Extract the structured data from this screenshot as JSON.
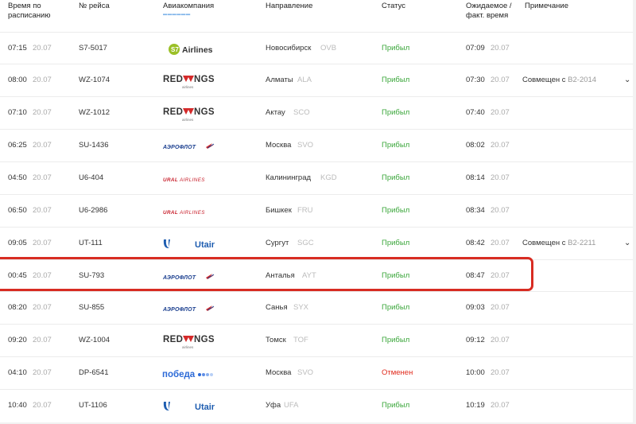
{
  "header": {
    "col_time": "Время по",
    "col_time_2": "расписанию",
    "col_flight": "№ рейса",
    "col_airline": "Авиакомпания",
    "col_direction": "Направление",
    "col_status": "Статус",
    "col_expected": "Ожидаемое /",
    "col_expected_2": "факт. время",
    "col_note": "Примечание"
  },
  "colors": {
    "arrived": "#3aa63a",
    "cancelled": "#e02a1c",
    "highlight": "#d82c22"
  },
  "rows": [
    {
      "time": "07:15",
      "date": "20.07",
      "flight": "S7-5017",
      "airline": "S7 Airlines",
      "city": "Новосибирск",
      "code": "OVB",
      "status": "Прибыл",
      "exp": "07:09",
      "exp_date": "20.07",
      "note": "",
      "note_code": ""
    },
    {
      "time": "08:00",
      "date": "20.07",
      "flight": "WZ-1074",
      "airline": "REDWINGS",
      "airline_sub": "airlines",
      "city": "Алматы",
      "code": "ALA",
      "status": "Прибыл",
      "exp": "07:30",
      "exp_date": "20.07",
      "note": "Совмещен с ",
      "note_code": "B2-2014"
    },
    {
      "time": "07:10",
      "date": "20.07",
      "flight": "WZ-1012",
      "airline": "REDWINGS",
      "airline_sub": "airlines",
      "city": "Актау",
      "code": "SCO",
      "status": "Прибыл",
      "exp": "07:40",
      "exp_date": "20.07",
      "note": "",
      "note_code": ""
    },
    {
      "time": "06:25",
      "date": "20.07",
      "flight": "SU-1436",
      "airline": "АЭРОФЛОТ",
      "city": "Москва",
      "code": "SVO",
      "status": "Прибыл",
      "exp": "08:02",
      "exp_date": "20.07",
      "note": "",
      "note_code": ""
    },
    {
      "time": "04:50",
      "date": "20.07",
      "flight": "U6-404",
      "airline": "URAL AIRLINES",
      "city": "Калининград",
      "code": "KGD",
      "status": "Прибыл",
      "exp": "08:14",
      "exp_date": "20.07",
      "note": "",
      "note_code": ""
    },
    {
      "time": "06:50",
      "date": "20.07",
      "flight": "U6-2986",
      "airline": "URAL AIRLINES",
      "city": "Бишкек",
      "code": "FRU",
      "status": "Прибыл",
      "exp": "08:34",
      "exp_date": "20.07",
      "note": "",
      "note_code": ""
    },
    {
      "time": "09:05",
      "date": "20.07",
      "flight": "UT-111",
      "airline": "Utair",
      "city": "Сургут",
      "code": "SGC",
      "status": "Прибыл",
      "exp": "08:42",
      "exp_date": "20.07",
      "note": "Совмещен с ",
      "note_code": "B2-2211"
    },
    {
      "time": "00:45",
      "date": "20.07",
      "flight": "SU-793",
      "airline": "АЭРОФЛОТ",
      "city": "Анталья",
      "code": "AYT",
      "status": "Прибыл",
      "exp": "08:47",
      "exp_date": "20.07",
      "note": "",
      "note_code": ""
    },
    {
      "time": "08:20",
      "date": "20.07",
      "flight": "SU-855",
      "airline": "АЭРОФЛОТ",
      "city": "Санья",
      "code": "SYX",
      "status": "Прибыл",
      "exp": "09:03",
      "exp_date": "20.07",
      "note": "",
      "note_code": ""
    },
    {
      "time": "09:20",
      "date": "20.07",
      "flight": "WZ-1004",
      "airline": "REDWINGS",
      "airline_sub": "airlines",
      "city": "Томск",
      "code": "TOF",
      "status": "Прибыл",
      "exp": "09:12",
      "exp_date": "20.07",
      "note": "",
      "note_code": ""
    },
    {
      "time": "04:10",
      "date": "20.07",
      "flight": "DP-6541",
      "airline": "победа",
      "city": "Москва",
      "code": "SVO",
      "status": "Отменен",
      "exp": "10:00",
      "exp_date": "20.07",
      "note": "",
      "note_code": ""
    },
    {
      "time": "10:40",
      "date": "20.07",
      "flight": "UT-1106",
      "airline": "Utair",
      "city": "Уфа",
      "code": "UFA",
      "status": "Прибыл",
      "exp": "10:19",
      "exp_date": "20.07",
      "note": "",
      "note_code": ""
    }
  ]
}
